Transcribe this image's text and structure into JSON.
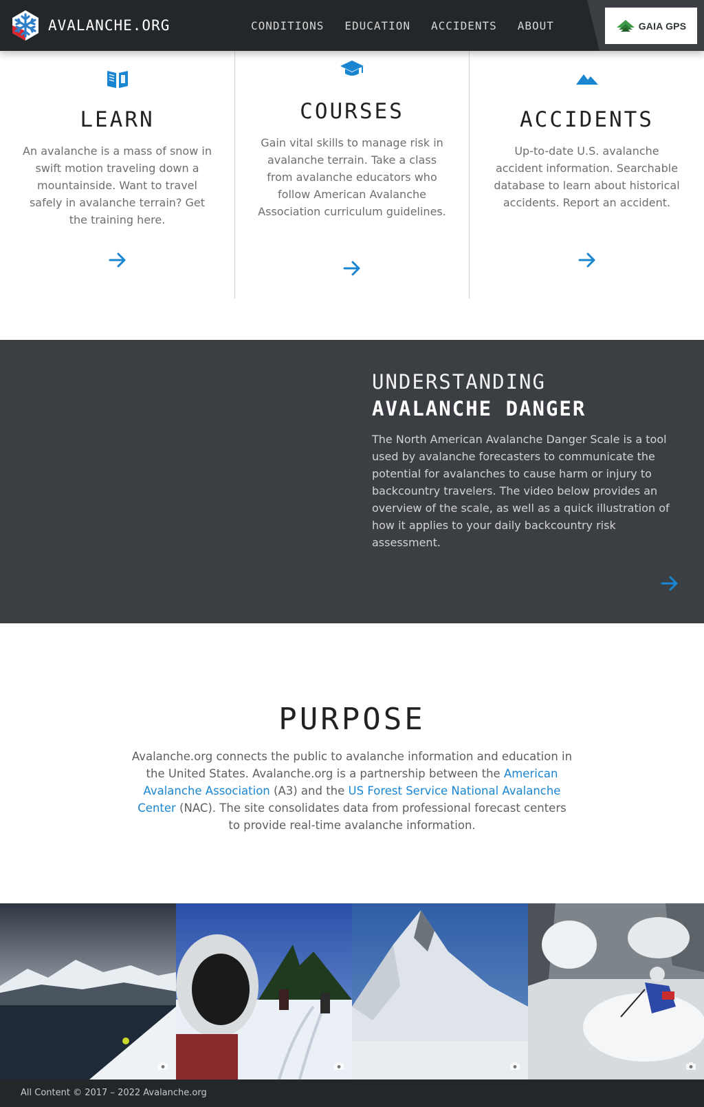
{
  "header": {
    "brand": "AVALANCHE.ORG",
    "nav": [
      "CONDITIONS",
      "EDUCATION",
      "ACCIDENTS",
      "ABOUT"
    ],
    "sponsor": "GAIA GPS"
  },
  "cards": [
    {
      "icon": "open-book-icon",
      "title": "LEARN",
      "text": "An avalanche is a mass of snow in swift motion traveling down a mountainside. Want to travel safely in avalanche terrain? Get the training here."
    },
    {
      "icon": "graduation-cap-icon",
      "title": "COURSES",
      "text": "Gain vital skills to manage risk in avalanche terrain. Take a class from avalanche educators who follow American Avalanche Association curriculum guidelines."
    },
    {
      "icon": "mountain-icon",
      "title": "ACCIDENTS",
      "text": "Up-to-date U.S. avalanche accident information. Searchable database to learn about historical accidents. Report an accident."
    }
  ],
  "danger": {
    "title_line1": "UNDERSTANDING",
    "title_line2": "AVALANCHE DANGER",
    "text": "The North American Avalanche Danger Scale is a tool used by avalanche forecasters to communicate the potential for avalanches to cause harm or injury to backcountry travelers. The video below provides an overview of the scale, as well as a quick illustration of how it applies to your daily backcountry risk assessment."
  },
  "purpose": {
    "title": "PURPOSE",
    "text_1": "Avalanche.org connects the public to avalanche information and education in the United States. Avalanche.org is a partnership between the ",
    "link_1": "American Avalanche Association",
    "text_2": " (A3) and the ",
    "link_2": "US Forest Service National Avalanche Center",
    "text_3": " (NAC). The site consolidates data from professional forecast centers to provide real-time avalanche information."
  },
  "gallery": {
    "photos": [
      "lake-mountain-photo",
      "snowmobile-helmet-photo",
      "snowy-peak-photo",
      "skier-powder-photo"
    ]
  },
  "footer": {
    "copyright": "All Content © 2017 – 2022 Avalanche.org"
  },
  "colors": {
    "accent": "#1a86d2",
    "header_bg": "#24272a",
    "section_bg": "#3b3e42"
  }
}
